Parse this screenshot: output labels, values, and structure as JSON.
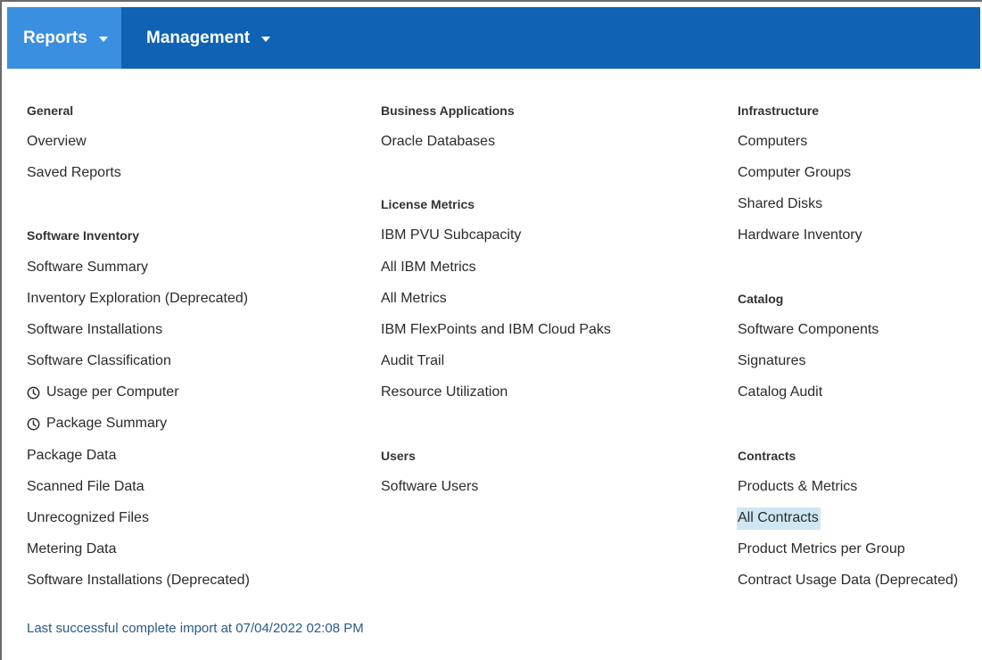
{
  "nav": {
    "reports_label": "Reports",
    "management_label": "Management"
  },
  "columns": {
    "general": {
      "heading": "General",
      "items": [
        "Overview",
        "Saved Reports"
      ]
    },
    "software_inventory": {
      "heading": "Software Inventory",
      "items": [
        "Software Summary",
        "Inventory Exploration (Deprecated)",
        "Software Installations",
        "Software Classification",
        "Usage per Computer",
        "Package Summary",
        "Package Data",
        "Scanned File Data",
        "Unrecognized Files",
        "Metering Data",
        "Software Installations (Deprecated)"
      ]
    },
    "business_applications": {
      "heading": "Business Applications",
      "items": [
        "Oracle Databases"
      ]
    },
    "license_metrics": {
      "heading": "License Metrics",
      "items": [
        "IBM PVU Subcapacity",
        "All IBM Metrics",
        "All Metrics",
        "IBM FlexPoints and IBM Cloud Paks",
        "Audit Trail",
        "Resource Utilization"
      ]
    },
    "users": {
      "heading": "Users",
      "items": [
        "Software Users"
      ]
    },
    "infrastructure": {
      "heading": "Infrastructure",
      "items": [
        "Computers",
        "Computer Groups",
        "Shared Disks",
        "Hardware Inventory"
      ]
    },
    "catalog": {
      "heading": "Catalog",
      "items": [
        "Software Components",
        "Signatures",
        "Catalog Audit"
      ]
    },
    "contracts": {
      "heading": "Contracts",
      "items": [
        "Products & Metrics",
        "All Contracts",
        "Product Metrics per Group",
        "Contract Usage Data (Deprecated)"
      ]
    }
  },
  "footer": {
    "import_status": "Last successful complete import at 07/04/2022 02:08 PM"
  },
  "colors": {
    "topbar": "#0f62b4",
    "active_tab": "#3b8fe0",
    "highlight": "#cfe6f3",
    "footer_text": "#2a5a8a"
  },
  "icons": {
    "usage_per_computer": "clock-icon",
    "package_summary": "clock-icon"
  }
}
